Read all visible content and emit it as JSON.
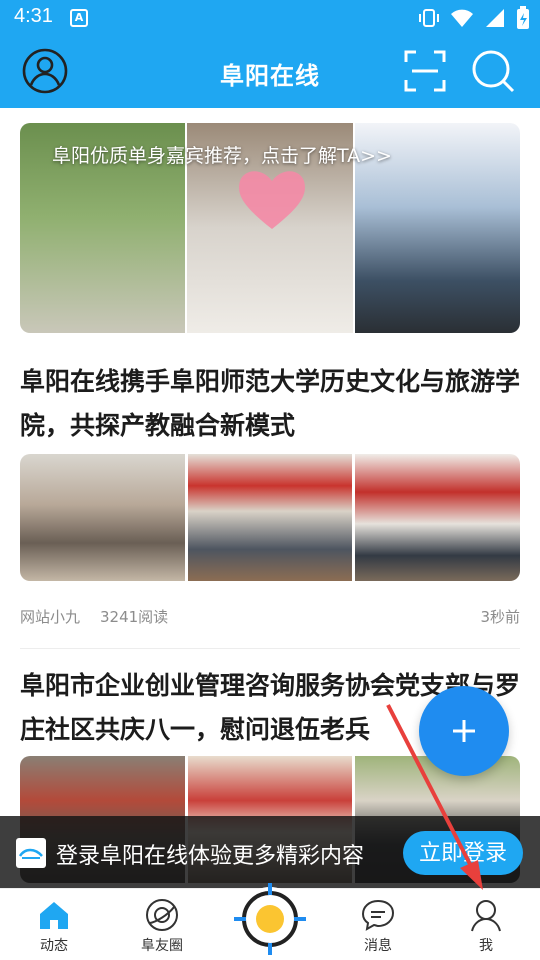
{
  "status_bar": {
    "time": "4:31",
    "notif_glyph": "A"
  },
  "header": {
    "title": "阜阳在线",
    "left_icon": "avatar-icon",
    "right_icons": [
      "scan-icon",
      "search-icon"
    ],
    "bg_color": "#1fa7f2"
  },
  "banner": {
    "text": "阜阳优质单身嘉宾推荐，点击了解TA>>"
  },
  "articles": [
    {
      "title": "阜阳在线携手阜阳师范大学历史文化与旅游学院，共探产教融合新模式",
      "author": "网站小九",
      "reads": "3241阅读",
      "time": "3秒前"
    },
    {
      "title": "阜阳市企业创业管理咨询服务协会党支部与罗庄社区共庆八一，慰问退伍老兵"
    }
  ],
  "login_bar": {
    "text": "登录阜阳在线体验更多精彩内容",
    "button": "立即登录"
  },
  "tabs": [
    {
      "label": "动态",
      "icon": "home-icon",
      "active": true
    },
    {
      "label": "阜友圈",
      "icon": "planet-icon"
    },
    {
      "label": "",
      "icon": "center-target-icon"
    },
    {
      "label": "消息",
      "icon": "message-icon"
    },
    {
      "label": "我",
      "icon": "user-icon"
    }
  ],
  "colors": {
    "accent": "#1fa7f2",
    "fab": "#1f8cf0",
    "annotation_arrow": "#e8403c"
  }
}
